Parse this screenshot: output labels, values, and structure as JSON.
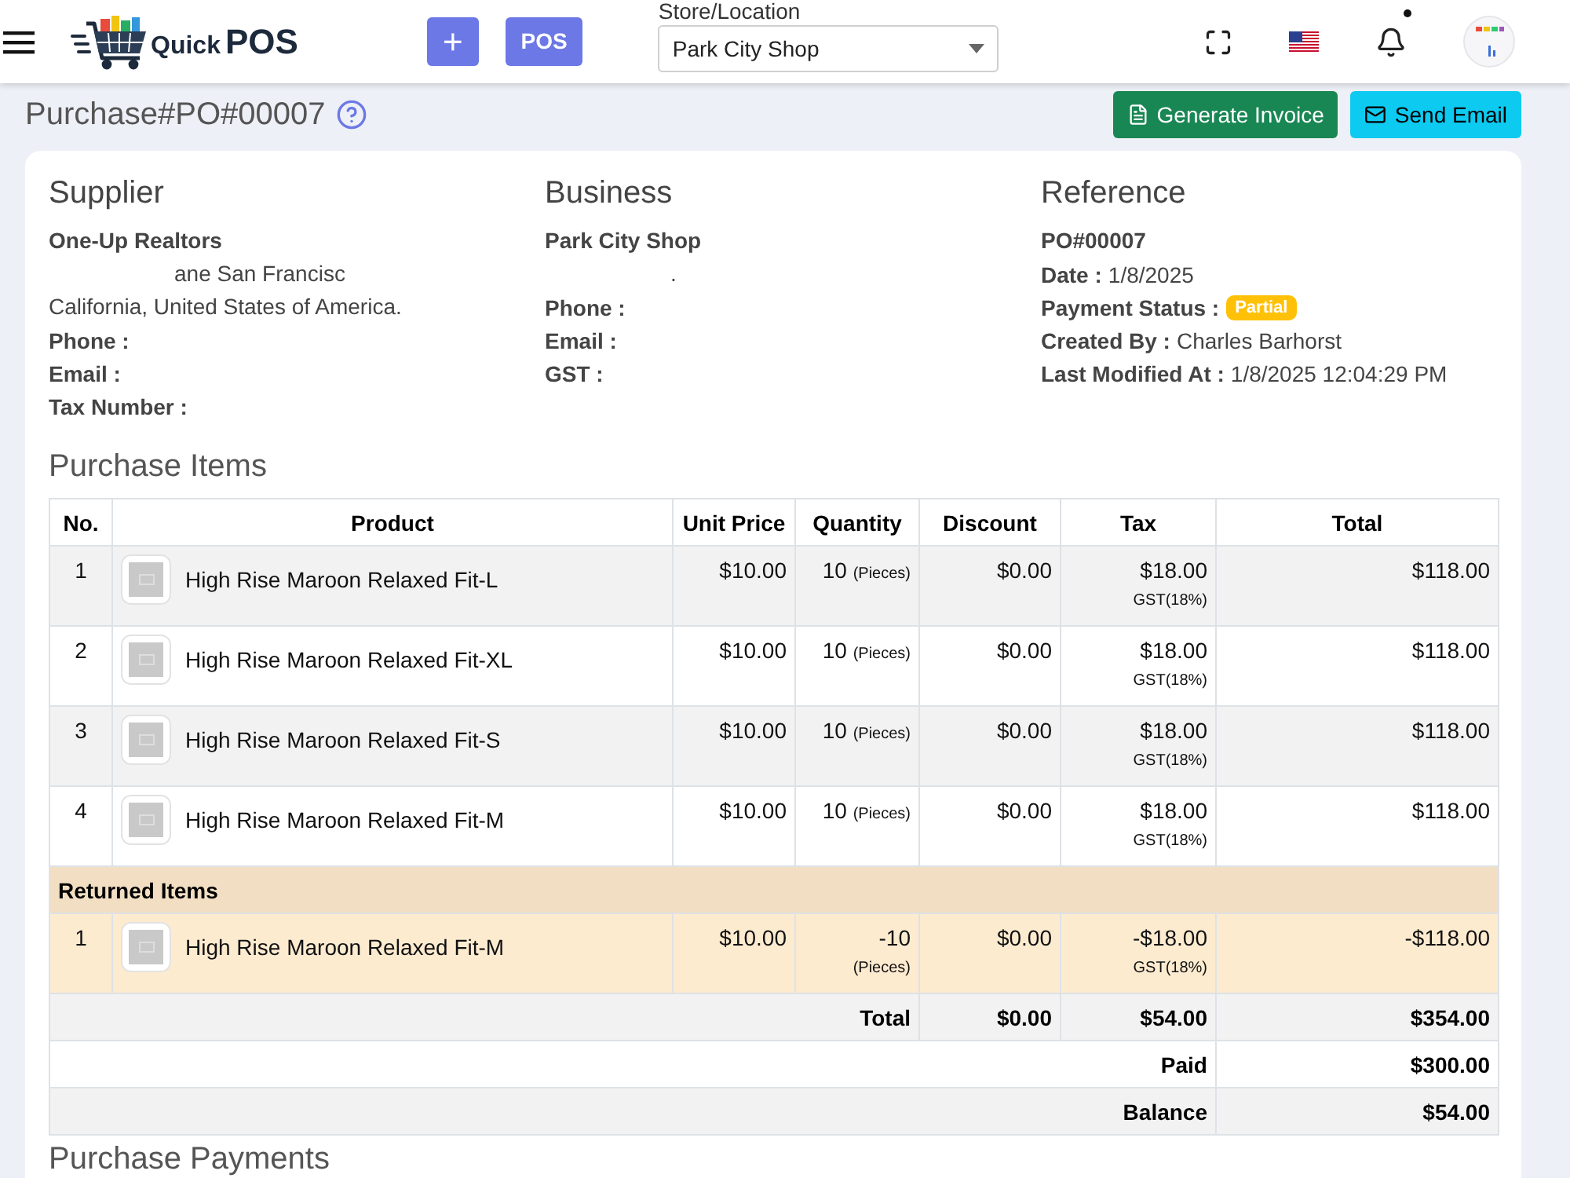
{
  "header": {
    "logo": {
      "first_word": "Quick",
      "second_word": "POS"
    },
    "add_button": "+",
    "pos_button": "POS",
    "store": {
      "label": "Store/Location",
      "value": "Park City Shop"
    }
  },
  "page": {
    "title": "Purchase#PO#00007",
    "actions": [
      {
        "label": "Generate Invoice",
        "kind": "invoice"
      },
      {
        "label": "Send Email",
        "kind": "email"
      }
    ]
  },
  "supplier": {
    "title": "Supplier",
    "name": "One-Up Realtors",
    "address": [
      {
        "text": "ane San Francisc",
        "kind": "cut"
      },
      {
        "text": "California, United States of America.",
        "kind": "full"
      }
    ],
    "fields": [
      {
        "label": "Phone :"
      },
      {
        "label": "Email :"
      },
      {
        "label": "Tax Number :"
      }
    ]
  },
  "business": {
    "title": "Business",
    "name": "Park City Shop",
    "address": [
      {
        "text": ".",
        "kind": "cut"
      }
    ],
    "fields": [
      {
        "label": "Phone :"
      },
      {
        "label": "Email :"
      },
      {
        "label": "GST :"
      }
    ]
  },
  "reference": {
    "title": "Reference",
    "number": "PO#00007",
    "fields": [
      {
        "label": "Date :",
        "value": "1/8/2025",
        "kind": "text"
      },
      {
        "label": "Payment Status :",
        "value": "Partial",
        "kind": "badge"
      },
      {
        "label": "Created By :",
        "value": "Charles Barhorst",
        "kind": "text"
      },
      {
        "label": "Last Modified At :",
        "value": "1/8/2025 12:04:29 PM",
        "kind": "text"
      }
    ]
  },
  "purchase_items": {
    "title": "Purchase Items",
    "columns": [
      "No.",
      "Product",
      "Unit Price",
      "Quantity",
      "Discount",
      "Tax",
      "Total"
    ],
    "rows": [
      {
        "no": "1",
        "product": "High Rise Maroon Relaxed Fit-L",
        "unit_price": "$10.00",
        "quantity": "10",
        "unit": "(Pieces)",
        "discount": "$0.00",
        "tax": "$18.00",
        "tax_name": "GST(18%)",
        "total": "$118.00"
      },
      {
        "no": "2",
        "product": "High Rise Maroon Relaxed Fit-XL",
        "unit_price": "$10.00",
        "quantity": "10",
        "unit": "(Pieces)",
        "discount": "$0.00",
        "tax": "$18.00",
        "tax_name": "GST(18%)",
        "total": "$118.00"
      },
      {
        "no": "3",
        "product": "High Rise Maroon Relaxed Fit-S",
        "unit_price": "$10.00",
        "quantity": "10",
        "unit": "(Pieces)",
        "discount": "$0.00",
        "tax": "$18.00",
        "tax_name": "GST(18%)",
        "total": "$118.00"
      },
      {
        "no": "4",
        "product": "High Rise Maroon Relaxed Fit-M",
        "unit_price": "$10.00",
        "quantity": "10",
        "unit": "(Pieces)",
        "discount": "$0.00",
        "tax": "$18.00",
        "tax_name": "GST(18%)",
        "total": "$118.00"
      }
    ],
    "returned": {
      "title": "Returned Items",
      "rows": [
        {
          "no": "1",
          "product": "High Rise Maroon Relaxed Fit-M",
          "unit_price": "$10.00",
          "quantity": "-10",
          "unit": "(Pieces)",
          "discount": "$0.00",
          "tax": "-$18.00",
          "tax_name": "GST(18%)",
          "total": "-$118.00"
        }
      ]
    },
    "summary": [
      {
        "label": "Total",
        "discount": "$0.00",
        "tax": "$54.00",
        "total": "$354.00"
      },
      {
        "label": "Paid",
        "total": "$300.00"
      },
      {
        "label": "Balance",
        "total": "$54.00"
      }
    ]
  },
  "purchase_payments": {
    "title": "Purchase Payments"
  }
}
